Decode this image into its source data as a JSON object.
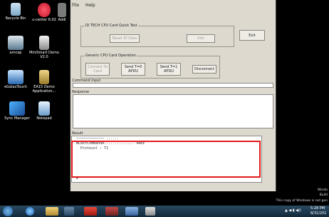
{
  "desktop": {
    "icons": [
      {
        "label": "Recycle Bin"
      },
      {
        "label": "u-center 6.02"
      },
      {
        "label": "Addi"
      },
      {
        "label": "amcap"
      },
      {
        "label": "MiniSmart Demo V2.0"
      },
      {
        "label": "eGalaxTouch"
      },
      {
        "label": "EA15 Demo Application..."
      },
      {
        "label": "Sync Manager"
      },
      {
        "label": "Notepad"
      }
    ]
  },
  "app": {
    "menu": {
      "file": "File",
      "help": "Help"
    },
    "quick_test": {
      "legend": "ID TECH CPU Card Quick Test",
      "reset_label": "Reset ID Data",
      "info_label": "Info",
      "exit_label": "Exit"
    },
    "generic_op": {
      "legend": "Generic CPU Card Operation",
      "connect_label": "Connect To Card",
      "send_t0_label": "Send T=0 APDU",
      "send_t1_label": "Send T=1 APDU",
      "disconnect_label": "Disconnect"
    },
    "command_input_label": "Command Input",
    "response_label": "Response",
    "result_label": "Result",
    "result_lines": [
      "――――――――――――― ...... ",
      "WLastCommandA.............. 4A6E",
      "  Protocol : T1"
    ],
    "result_bottom_mark": "#"
  },
  "watermark": {
    "line1": "Windo",
    "line2": "Build",
    "line3": "This copy of Windows is not gen"
  },
  "tray": {
    "time": "5:28 PM",
    "date": "8/31/201"
  },
  "colors": {
    "highlight": "#e21b1b",
    "window_bg": "#ddd9cf"
  }
}
